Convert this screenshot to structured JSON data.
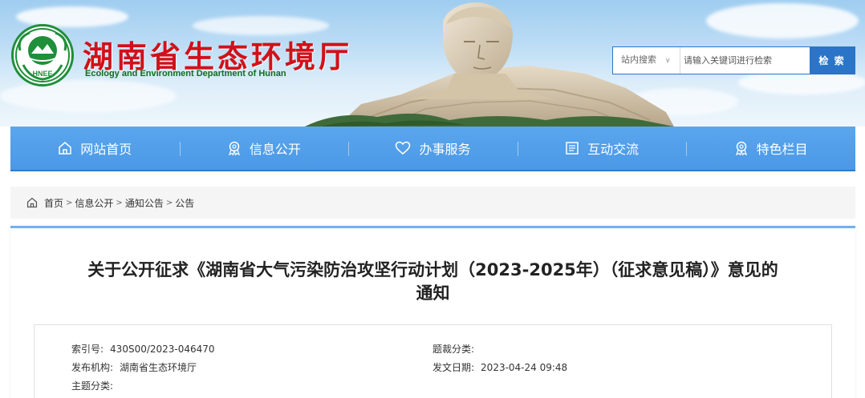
{
  "header": {
    "site_title": "湖南省生态环境厅",
    "site_subtitle": "Ecology and Environment Department of Hunan",
    "logo_text": "HNEE"
  },
  "search": {
    "scope_label": "站内搜索",
    "scope_arrow": "v",
    "placeholder": "请输入关键词进行检索",
    "button_label": "检 索"
  },
  "nav": {
    "items": [
      {
        "label": "网站首页",
        "icon": "home-icon"
      },
      {
        "label": "信息公开",
        "icon": "badge-icon"
      },
      {
        "label": "办事服务",
        "icon": "heart-icon"
      },
      {
        "label": "互动交流",
        "icon": "document-icon"
      },
      {
        "label": "特色栏目",
        "icon": "badge-icon"
      }
    ]
  },
  "breadcrumb": {
    "items": [
      "首页",
      "信息公开",
      "通知公告",
      "公告"
    ],
    "separator": ">"
  },
  "article": {
    "title_line1": "关于公开征求《湖南省大气污染防治攻坚行动计划（2023-2025年）（征求意见稿）》意见的",
    "title_line2": "通知"
  },
  "meta": {
    "index_label": "索引号:",
    "index_value": "430S00/2023-046470",
    "category_label": "题裁分类:",
    "category_value": "",
    "publisher_label": "发布机构:",
    "publisher_value": "湖南省生态环境厅",
    "date_label": "发文日期:",
    "date_value": "2023-04-24 09:48",
    "topic_label": "主题分类:",
    "topic_value": ""
  },
  "colors": {
    "title_red": "#d0111b",
    "subtitle_green": "#156a22",
    "nav_blue": "#4b98e6",
    "search_blue": "#2a75c8"
  }
}
